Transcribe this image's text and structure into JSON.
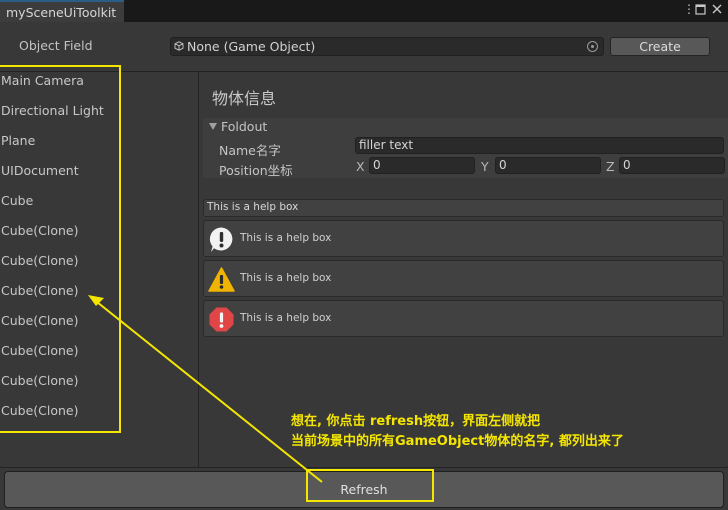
{
  "window": {
    "tab_title": "mySceneUiToolkit",
    "menu_icon": "more-vertical-icon",
    "maximize_icon": "maximize-icon",
    "close_icon": "close-icon"
  },
  "object_field": {
    "label": "Object Field",
    "value": "None (Game Object)",
    "create_label": "Create"
  },
  "scene_list": {
    "items": [
      "Main Camera",
      "Directional Light",
      "Plane",
      "UIDocument",
      "Cube",
      "Cube(Clone)",
      "Cube(Clone)",
      "Cube(Clone)",
      "Cube(Clone)",
      "Cube(Clone)",
      "Cube(Clone)",
      "Cube(Clone)"
    ]
  },
  "inspector": {
    "title": "物体信息",
    "foldout_label": "Foldout",
    "name_label": "Name名字",
    "name_value": "filler text",
    "position_label": "Position坐标",
    "x_label": "X",
    "x_value": "0",
    "y_label": "Y",
    "y_value": "0",
    "z_label": "Z",
    "z_value": "0"
  },
  "help_boxes": {
    "plain": "This is a help box",
    "info": "This is a help box",
    "warning": "This is a help box",
    "error": "This is a help box"
  },
  "refresh_label": "Refresh",
  "annotation": {
    "line1": "想在, 你点击 refresh按钮，界面左侧就把",
    "line2": "当前场景中的所有GameObject物体的名字, 都列出来了",
    "color": "#f5e600"
  },
  "colors": {
    "background": "#383838",
    "button": "#585858",
    "tab_accent": "#2c5d87",
    "warning": "#f0b400",
    "error": "#e04646"
  }
}
